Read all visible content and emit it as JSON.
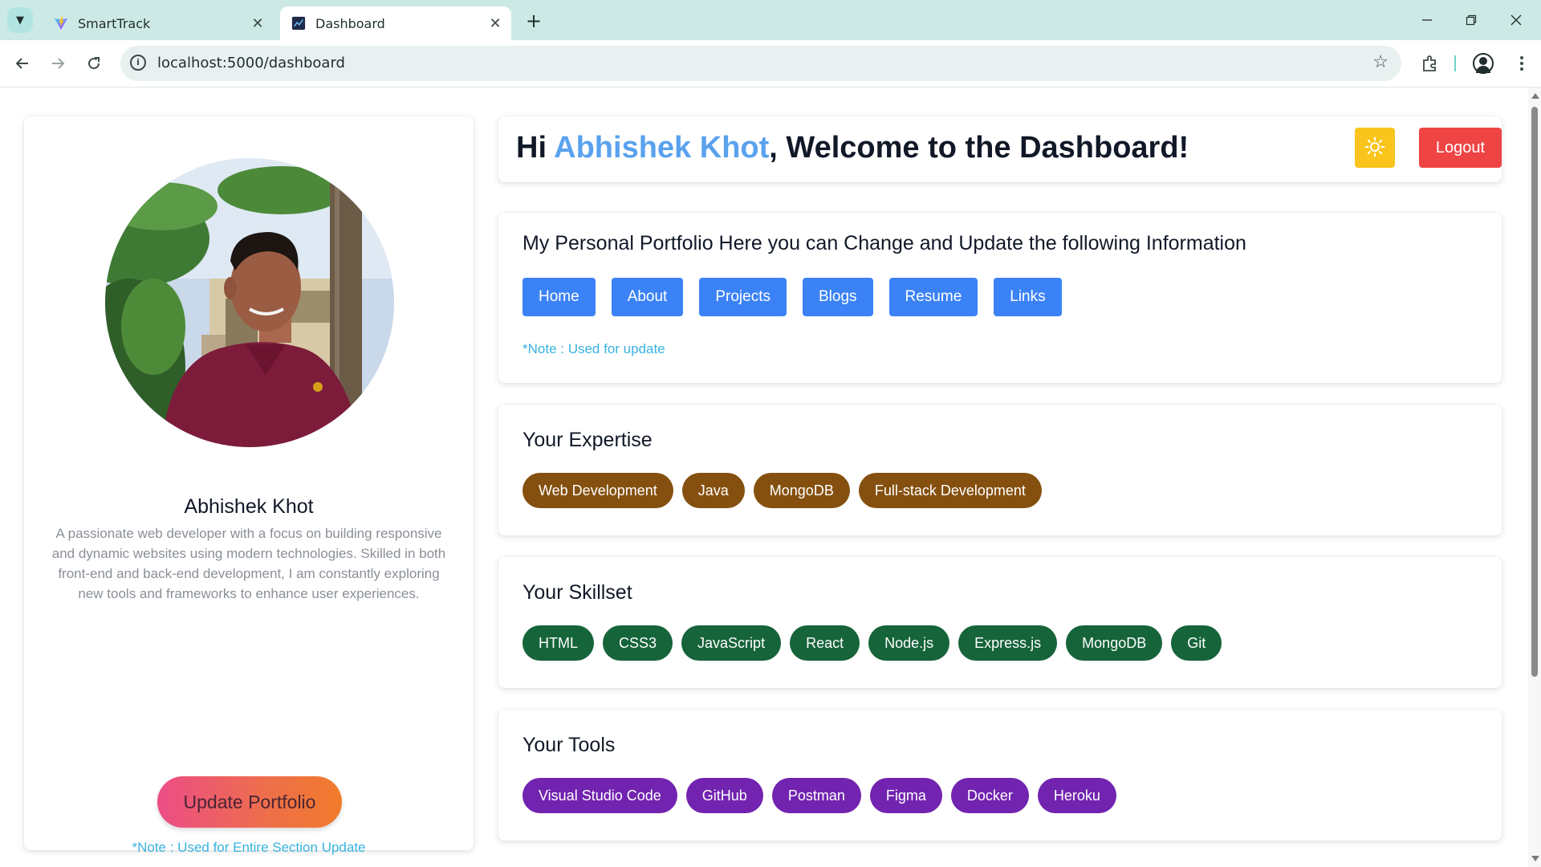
{
  "browser": {
    "tabs": [
      {
        "title": "SmartTrack",
        "active": false
      },
      {
        "title": "Dashboard",
        "active": true
      }
    ],
    "url": "localhost:5000/dashboard",
    "icons": {
      "tab_menu": "chevron-down-icon",
      "tab_close": "close-icon",
      "new_tab": "plus-icon",
      "back": "arrow-left-icon",
      "forward": "arrow-right-icon",
      "reload": "reload-icon",
      "site_info": "info-icon",
      "bookmark": "star-icon",
      "extensions": "puzzle-icon",
      "profile": "account-icon",
      "menu": "kebab-menu-icon"
    },
    "window_controls": [
      "minimize",
      "restore",
      "close"
    ]
  },
  "profile": {
    "name": "Abhishek Khot",
    "bio": "A passionate web developer with a focus on building responsive and dynamic websites using modern technologies. Skilled in both front-end and back-end development, I am constantly exploring new tools and frameworks to enhance user experiences.",
    "update_button": "Update Portfolio",
    "note": "*Note : Used for Entire Section Update"
  },
  "header": {
    "greeting_prefix": "Hi ",
    "username": "Abhishek Khot",
    "greeting_suffix": ", Welcome to the Dashboard!",
    "theme_icon": "sun-icon",
    "logout_label": "Logout"
  },
  "portfolio": {
    "title": "My Personal Portfolio Here you can Change and Update the following Information",
    "sections": [
      "Home",
      "About",
      "Projects",
      "Blogs",
      "Resume",
      "Links"
    ],
    "note": "*Note : Used for update"
  },
  "expertise": {
    "title": "Your Expertise",
    "items": [
      "Web Development",
      "Java",
      "MongoDB",
      "Full-stack Development"
    ]
  },
  "skillset": {
    "title": "Your Skillset",
    "items": [
      "HTML",
      "CSS3",
      "JavaScript",
      "React",
      "Node.js",
      "Express.js",
      "MongoDB",
      "Git"
    ]
  },
  "tools": {
    "title": "Your Tools",
    "items": [
      "Visual Studio Code",
      "GitHub",
      "Postman",
      "Figma",
      "Docker",
      "Heroku"
    ]
  },
  "colors": {
    "accent_blue": "#3b82f6",
    "username_blue": "#5aa2ee",
    "note_cyan": "#38b2e0",
    "expertise_brown": "#85500f",
    "skill_green": "#16643a",
    "tool_purple": "#7223b0",
    "logout_red": "#ee4444",
    "theme_yellow": "#f9c51c"
  }
}
